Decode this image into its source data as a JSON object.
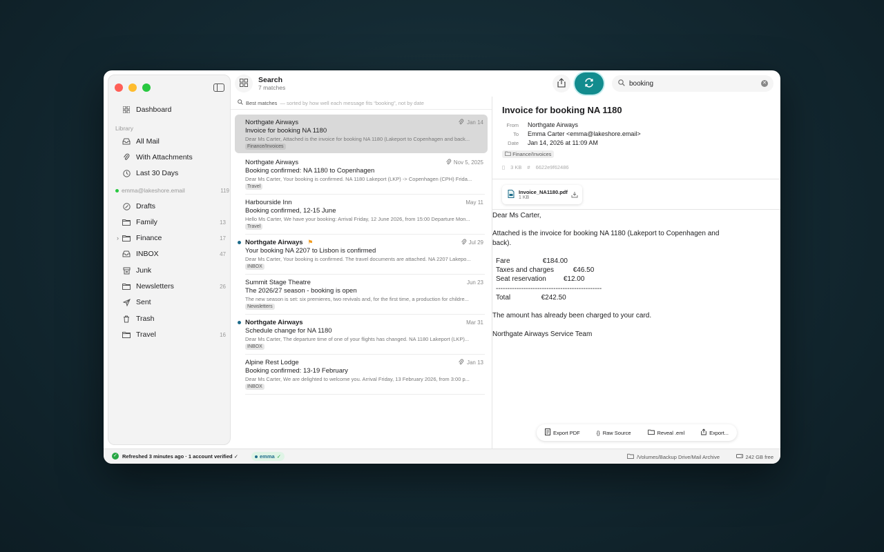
{
  "search": {
    "title": "Search",
    "subtitle": "7 matches",
    "query": "booking"
  },
  "sidebar": {
    "dashboard": "Dashboard",
    "library_label": "Library",
    "library": [
      {
        "label": "All Mail",
        "icon": "tray-icon"
      },
      {
        "label": "With Attachments",
        "icon": "paperclip-icon"
      },
      {
        "label": "Last 30 Days",
        "icon": "clock-icon"
      }
    ],
    "account": "emma@lakeshore.email",
    "account_count": "119",
    "folders": [
      {
        "label": "Drafts",
        "count": "",
        "icon": "drafts-icon"
      },
      {
        "label": "Family",
        "count": "13",
        "icon": "folder-icon"
      },
      {
        "label": "Finance",
        "count": "17",
        "icon": "folder-icon"
      },
      {
        "label": "INBOX",
        "count": "47",
        "icon": "inbox-icon"
      },
      {
        "label": "Junk",
        "count": "",
        "icon": "junk-icon"
      },
      {
        "label": "Newsletters",
        "count": "26",
        "icon": "folder-icon"
      },
      {
        "label": "Sent",
        "count": "",
        "icon": "paperplane-icon"
      },
      {
        "label": "Trash",
        "count": "",
        "icon": "trash-icon"
      },
      {
        "label": "Travel",
        "count": "16",
        "icon": "folder-icon"
      }
    ]
  },
  "list": {
    "best_label": "Best matches",
    "best_note": "— sorted by how well each message fits “booking”, not by date",
    "messages": [
      {
        "sender": "Northgate Airways",
        "date": "Jan 14",
        "subject": "Invoice for booking NA 1180",
        "preview": "Dear Ms Carter, Attached is the invoice for booking NA 1180 (Lakeport to Copenhagen and back...",
        "tag": "Finance/Invoices"
      },
      {
        "sender": "Northgate Airways",
        "date": "Nov 5, 2025",
        "subject": "Booking confirmed: NA 1180 to Copenhagen",
        "preview": "Dear Ms Carter, Your booking is confirmed. NA 1180 Lakeport (LKP) -> Copenhagen (CPH) Frida...",
        "tag": "Travel"
      },
      {
        "sender": "Harbourside Inn",
        "date": "May 11",
        "subject": "Booking confirmed, 12-15 June",
        "preview": "Hello Ms Carter, We have your booking: Arrival Friday, 12 June 2026, from 15:00 Departure Mon...",
        "tag": "Travel"
      },
      {
        "sender": "Northgate Airways",
        "date": "Jul 29",
        "subject": "Your booking NA 2207 to Lisbon is confirmed",
        "preview": "Dear Ms Carter, Your booking is confirmed. The travel documents are attached. NA 2207 Lakepo...",
        "tag": "INBOX"
      },
      {
        "sender": "Summit Stage Theatre",
        "date": "Jun 23",
        "subject": "The 2026/27 season - booking is open",
        "preview": "The new season is set: six premieres, two revivals and, for the first time, a production for childre...",
        "tag": "Newsletters"
      },
      {
        "sender": "Northgate Airways",
        "date": "Mar 31",
        "subject": "Schedule change for NA 1180",
        "preview": "Dear Ms Carter, The departure time of one of your flights has changed. NA 1180 Lakeport (LKP)...",
        "tag": "INBOX"
      },
      {
        "sender": "Alpine Rest Lodge",
        "date": "Jan 13",
        "subject": "Booking confirmed: 13-19 February",
        "preview": "Dear Ms Carter, We are delighted to welcome you. Arrival Friday, 13 February 2026, from 3:00 p...",
        "tag": "INBOX"
      }
    ]
  },
  "reader": {
    "title": "Invoice for booking NA 1180",
    "from_label": "From",
    "from": "Northgate Airways",
    "to_label": "To",
    "to": "Emma Carter <emma@lakeshore.email>",
    "date_label": "Date",
    "date": "Jan 14, 2026 at 11:09 AM",
    "tag": "Finance/Invoices",
    "size": "3 KB",
    "hash": "6622e9f62486",
    "attachment": {
      "name": "Invoice_NA1180.pdf",
      "size": "1 KB"
    },
    "greeting": "Dear Ms Carter,",
    "intro": "Attached is the invoice for booking NA 1180 (Lakeport to Copenhagen and back).",
    "table": "Fare                 €184.00\nTaxes and charges          €46.50\nSeat reservation         €12.00\n----------------------------------------------\nTotal                €242.50",
    "charged": "The amount has already been charged to your card.",
    "signoff": "Northgate Airways Service Team",
    "actions": [
      "Export PDF",
      "Raw Source",
      "Reveal .eml",
      "Export..."
    ]
  },
  "status": {
    "refreshed": "Refreshed 3 minutes ago · 1 account verified ✓",
    "account": "emma",
    "path": "/Volumes/Backup Drive/Mail Archive",
    "free": "242 GB free"
  }
}
